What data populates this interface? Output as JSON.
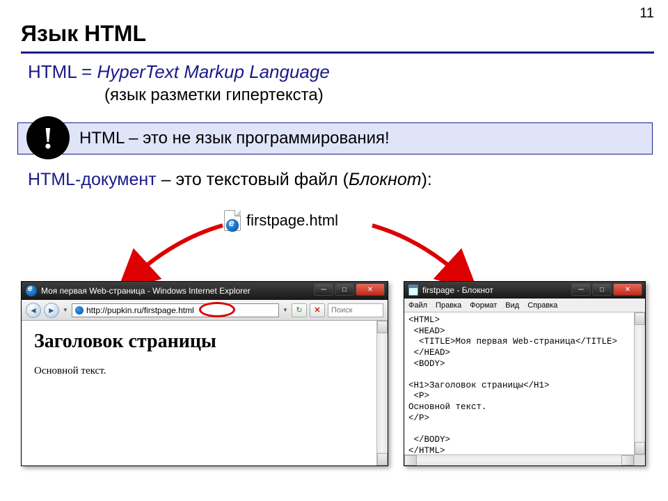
{
  "page_number": "11",
  "title": "Язык HTML",
  "definition": {
    "prefix": "HTML = ",
    "expansion": "HyperText Markup Language",
    "translation": "(язык разметки гипертекста)"
  },
  "alert": {
    "icon_char": "!",
    "text": "HTML – это не язык программирования!"
  },
  "doc_line": {
    "term": "HTML-документ",
    "middle": " – это текстовый файл (",
    "italic": "Блокнот",
    "after": "):"
  },
  "file": {
    "name": "firstpage.html"
  },
  "browser": {
    "title": "Моя первая Web-страница - Windows Internet Explorer",
    "url": "http://pupkin.ru/firstpage.html",
    "search_placeholder": "Поиск",
    "page_h1": "Заголовок страницы",
    "page_body": "Основной текст."
  },
  "notepad": {
    "title": "firstpage - Блокнот",
    "menu": [
      "Файл",
      "Правка",
      "Формат",
      "Вид",
      "Справка"
    ],
    "content": "<HTML>\n <HEAD>\n  <TITLE>Моя первая Web-страница</TITLE>\n </HEAD>\n <BODY>\n\n<H1>Заголовок страницы</H1>\n <P>\nОсновной текст.\n</P>\n\n </BODY>\n</HTML>"
  }
}
